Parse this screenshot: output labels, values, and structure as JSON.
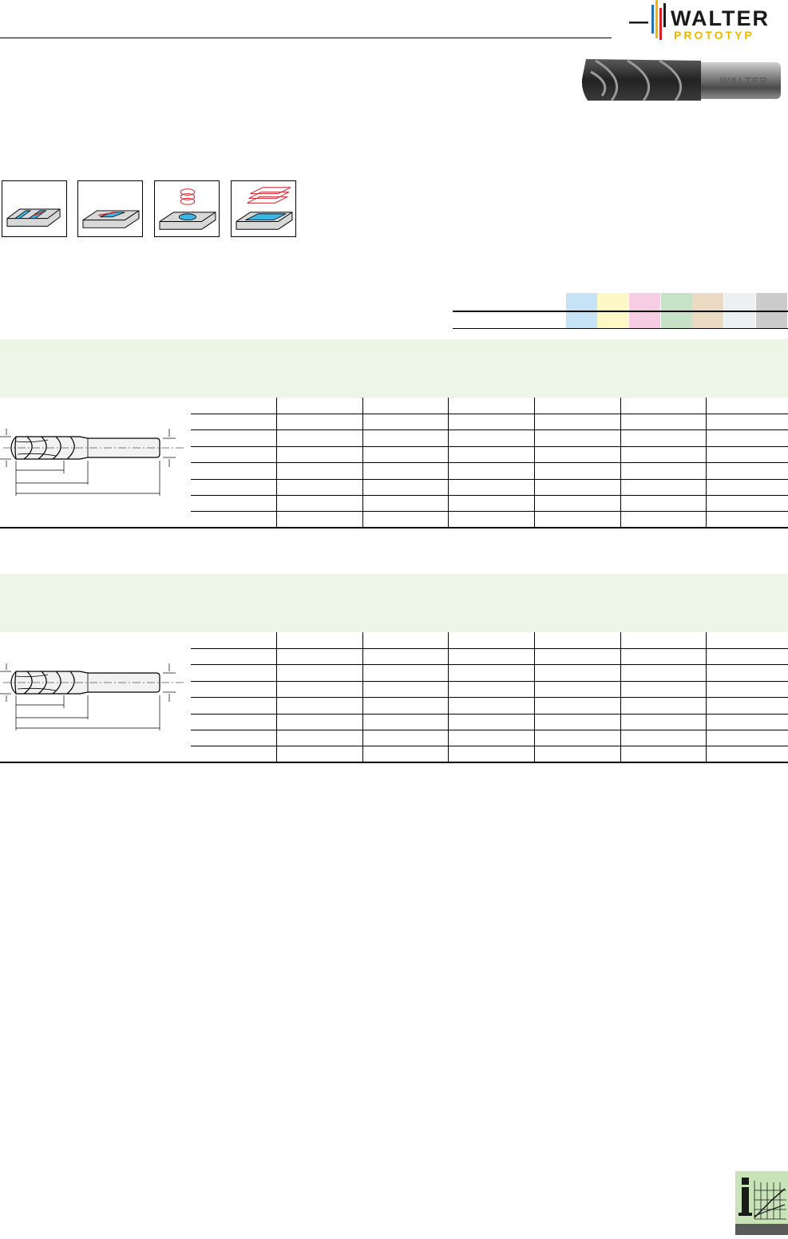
{
  "brand": {
    "name": "WALTER",
    "subname": "PROTOTYP",
    "colors": {
      "accent_yellow": "#f2b600",
      "accent_blue": "#1f72b8",
      "accent_red": "#d6202a",
      "dark": "#1a1a1a"
    }
  },
  "product_image": {
    "icon": "end-mill-photo-icon",
    "engraving": "WALTER"
  },
  "operations": [
    {
      "icon": "slot-milling-icon"
    },
    {
      "icon": "ramping-icon"
    },
    {
      "icon": "helical-plunge-icon"
    },
    {
      "icon": "pocket-milling-icon"
    }
  ],
  "material_legend": {
    "colors": [
      "#c5e3f5",
      "#fdf8c6",
      "#f6cde2",
      "#c6e3c7",
      "#ecd9c3",
      "#edf0f1",
      "#cbcbcb"
    ]
  },
  "sections": [
    {
      "band_color": "#edf6e6",
      "rows": 7,
      "cols": 7,
      "drawing_icon": "end-mill-drawing-icon"
    },
    {
      "band_color": "#edf6e6",
      "rows": 7,
      "cols": 7,
      "drawing_icon": "end-mill-drawing-icon"
    }
  ],
  "footer": {
    "icon": "info-graph-icon"
  }
}
